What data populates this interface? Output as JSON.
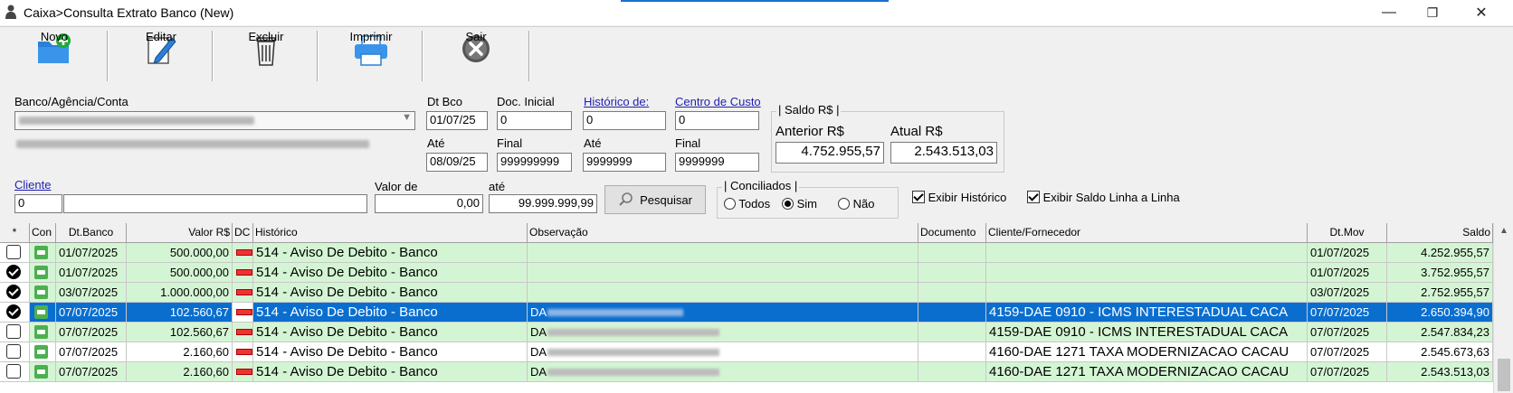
{
  "window": {
    "title": "Caixa>Consulta Extrato Banco (New)",
    "minimize": "—",
    "maximize": "❐",
    "close": "✕"
  },
  "toolbar": {
    "novo": "Novo",
    "editar": "Editar",
    "excluir": "Excluir",
    "imprimir": "Imprimir",
    "sair": "Sair"
  },
  "filters": {
    "banco_label": "Banco/Agência/Conta",
    "dt_bco_label": "Dt Bco",
    "dt_bco_value": "01/07/25",
    "ate_label": "Até",
    "dt_ate_value": "08/09/25",
    "doc_inicial_label": "Doc. Inicial",
    "doc_inicial_value": "0",
    "doc_final_label": "Final",
    "doc_final_value": "999999999",
    "historico_label": "Histórico de:",
    "historico_value": "0",
    "historico_ate_label": "Até",
    "historico_ate_value": "9999999",
    "centro_label": "Centro de Custo",
    "centro_value": "0",
    "centro_final_label": "Final",
    "centro_final_value": "9999999",
    "cliente_label": "Cliente",
    "cliente_code": "0",
    "cliente_name": "",
    "valor_de_label": "Valor de",
    "valor_de_value": "0,00",
    "valor_ate_label": "até",
    "valor_ate_value": "99.999.999,99",
    "pesquisar": "Pesquisar"
  },
  "saldo": {
    "group_title": "Saldo R$",
    "anterior_label": "Anterior R$",
    "anterior_value": "4.752.955,57",
    "atual_label": "Atual R$",
    "atual_value": "2.543.513,03"
  },
  "conciliados": {
    "group_title": "Conciliados",
    "options": [
      "Todos",
      "Sim",
      "Não"
    ],
    "selected": "Sim"
  },
  "options": {
    "exibir_historico": "Exibir Histórico",
    "exibir_saldo": "Exibir Saldo Linha a Linha"
  },
  "grid": {
    "headers": {
      "star": "*",
      "con": "Con",
      "dt_banco": "Dt.Banco",
      "valor": "Valor R$",
      "dc": "DC",
      "historico": "Histórico",
      "observacao": "Observação",
      "documento": "Documento",
      "cliente": "Cliente/Fornecedor",
      "dt_mov": "Dt.Mov",
      "saldo": "Saldo"
    },
    "rows": [
      {
        "checked": false,
        "dt": "01/07/2025",
        "valor": "500.000,00",
        "hist": "514 - Aviso De Debito - Banco",
        "obs": "",
        "doc": "",
        "cli": "",
        "dtmov": "01/07/2025",
        "saldo": "4.252.955,57"
      },
      {
        "checked": true,
        "dt": "01/07/2025",
        "valor": "500.000,00",
        "hist": "514 - Aviso De Debito - Banco",
        "obs": "",
        "doc": "",
        "cli": "",
        "dtmov": "01/07/2025",
        "saldo": "3.752.955,57"
      },
      {
        "checked": true,
        "dt": "03/07/2025",
        "valor": "1.000.000,00",
        "hist": "514 - Aviso De Debito - Banco",
        "obs": "",
        "doc": "",
        "cli": "",
        "dtmov": "03/07/2025",
        "saldo": "2.752.955,57"
      },
      {
        "checked": true,
        "dt": "07/07/2025",
        "valor": "102.560,67",
        "hist": "514 - Aviso De Debito - Banco",
        "obs": "DA",
        "doc": "",
        "cli": "4159-DAE 0910 - ICMS INTERESTADUAL CACA",
        "dtmov": "07/07/2025",
        "saldo": "2.650.394,90"
      },
      {
        "checked": false,
        "dt": "07/07/2025",
        "valor": "102.560,67",
        "hist": "514 - Aviso De Debito - Banco",
        "obs": "DA",
        "doc": "",
        "cli": "4159-DAE 0910 - ICMS INTERESTADUAL CACA",
        "dtmov": "07/07/2025",
        "saldo": "2.547.834,23"
      },
      {
        "checked": false,
        "dt": "07/07/2025",
        "valor": "2.160,60",
        "hist": "514 - Aviso De Debito - Banco",
        "obs": "DA",
        "doc": "",
        "cli": "4160-DAE 1271 TAXA MODERNIZACAO CACAU",
        "dtmov": "07/07/2025",
        "saldo": "2.545.673,63"
      },
      {
        "checked": false,
        "dt": "07/07/2025",
        "valor": "2.160,60",
        "hist": "514 - Aviso De Debito - Banco",
        "obs": "DA",
        "doc": "",
        "cli": "4160-DAE 1271 TAXA MODERNIZACAO CACAU",
        "dtmov": "07/07/2025",
        "saldo": "2.543.513,03"
      }
    ]
  }
}
